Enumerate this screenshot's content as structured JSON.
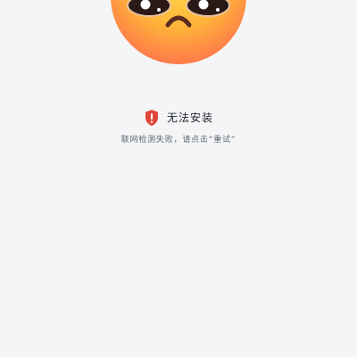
{
  "status": {
    "title": "无法安装",
    "message": "联网检测失败，请点击“重试”",
    "icon": "shield-alert-icon",
    "icon_color": "#e2473b"
  },
  "illustration": {
    "icon": "sad-face-emoji-icon"
  },
  "colors": {
    "background": "#f4f5f7",
    "emoji_top": "#ffd23a",
    "emoji_bottom": "#ff7f45"
  }
}
